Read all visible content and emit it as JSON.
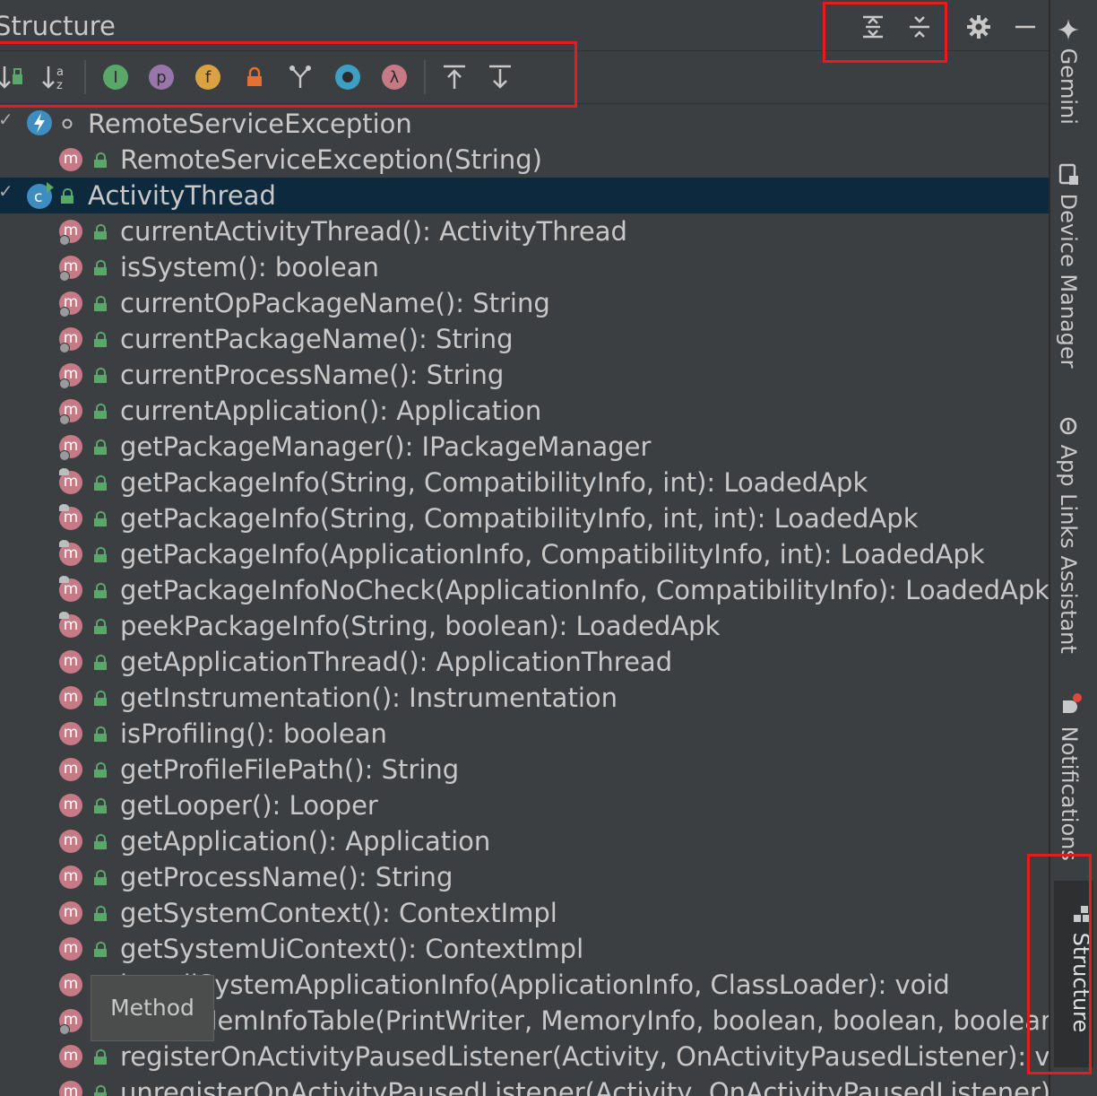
{
  "panel": {
    "title": "Structure",
    "header_buttons": [
      "expand-all-icon",
      "collapse-all-icon",
      "gear-icon",
      "minimize-icon"
    ]
  },
  "toolbar": {
    "buttons": [
      "sort-by-visibility-icon",
      "sort-alphabetically-icon",
      "show-inherited-icon",
      "show-properties-icon",
      "show-fields-icon",
      "show-non-public-icon",
      "show-anonymous-classes-icon",
      "show-lambdas-icon",
      "show-lambda-icon",
      "navigate-from-source-icon",
      "navigate-to-source-icon"
    ],
    "badges": {
      "inherited": "I",
      "properties": "p",
      "fields": "f",
      "lambda": "λ"
    }
  },
  "tree": {
    "nodes": [
      {
        "text": "RemoteServiceException",
        "kind": "class"
      },
      {
        "text": "RemoteServiceException(String)",
        "kind": "method"
      },
      {
        "text": "ActivityThread",
        "kind": "class",
        "selected": true
      },
      {
        "text": "currentActivityThread(): ActivityThread",
        "kind": "method"
      },
      {
        "text": "isSystem(): boolean",
        "kind": "method"
      },
      {
        "text": "currentOpPackageName(): String",
        "kind": "method"
      },
      {
        "text": "currentPackageName(): String",
        "kind": "method"
      },
      {
        "text": "currentProcessName(): String",
        "kind": "method"
      },
      {
        "text": "currentApplication(): Application",
        "kind": "method"
      },
      {
        "text": "getPackageManager(): IPackageManager",
        "kind": "method"
      },
      {
        "text": "getPackageInfo(String, CompatibilityInfo, int): LoadedApk",
        "kind": "method"
      },
      {
        "text": "getPackageInfo(String, CompatibilityInfo, int, int): LoadedApk",
        "kind": "method"
      },
      {
        "text": "getPackageInfo(ApplicationInfo, CompatibilityInfo, int): LoadedApk",
        "kind": "method"
      },
      {
        "text": "getPackageInfoNoCheck(ApplicationInfo, CompatibilityInfo): LoadedApk",
        "kind": "method"
      },
      {
        "text": "peekPackageInfo(String, boolean): LoadedApk",
        "kind": "method"
      },
      {
        "text": "getApplicationThread(): ApplicationThread",
        "kind": "method"
      },
      {
        "text": "getInstrumentation(): Instrumentation",
        "kind": "method"
      },
      {
        "text": "isProfiling(): boolean",
        "kind": "method"
      },
      {
        "text": "getProfileFilePath(): String",
        "kind": "method"
      },
      {
        "text": "getLooper(): Looper",
        "kind": "method"
      },
      {
        "text": "getApplication(): Application",
        "kind": "method"
      },
      {
        "text": "getProcessName(): String",
        "kind": "method"
      },
      {
        "text": "getSystemContext(): ContextImpl",
        "kind": "method"
      },
      {
        "text": "getSystemUiContext(): ContextImpl",
        "kind": "method"
      },
      {
        "text": "installSystemApplicationInfo(ApplicationInfo, ClassLoader): void",
        "kind": "method"
      },
      {
        "text": "dumpMemInfoTable(PrintWriter, MemoryInfo, boolean, boolean, boolean,",
        "kind": "method"
      },
      {
        "text": "registerOnActivityPausedListener(Activity, OnActivityPausedListener): void",
        "kind": "method"
      },
      {
        "text": "unregisterOnActivityPausedListener(Activity, OnActivityPausedListener): void",
        "kind": "method"
      }
    ],
    "method_icon_letter": "m"
  },
  "tooltip": {
    "text": "Method"
  },
  "right_strip": {
    "tabs": [
      {
        "label": "Gemini",
        "icon": "sparkle-icon"
      },
      {
        "label": "Device Manager",
        "icon": "device-icon"
      },
      {
        "label": "App Links Assistant",
        "icon": "link-icon"
      },
      {
        "label": "Notifications",
        "icon": "bell-icon"
      },
      {
        "label": "Structure",
        "icon": "structure-icon",
        "active": true
      }
    ]
  },
  "colors": {
    "panel_bg": "#3c3f41",
    "selection_bg": "#0d293e",
    "method_icon": "#c57a86",
    "class_icon": "#3d8cc2",
    "access_lock": "#59a869",
    "highlight_box": "#e81b1b"
  }
}
